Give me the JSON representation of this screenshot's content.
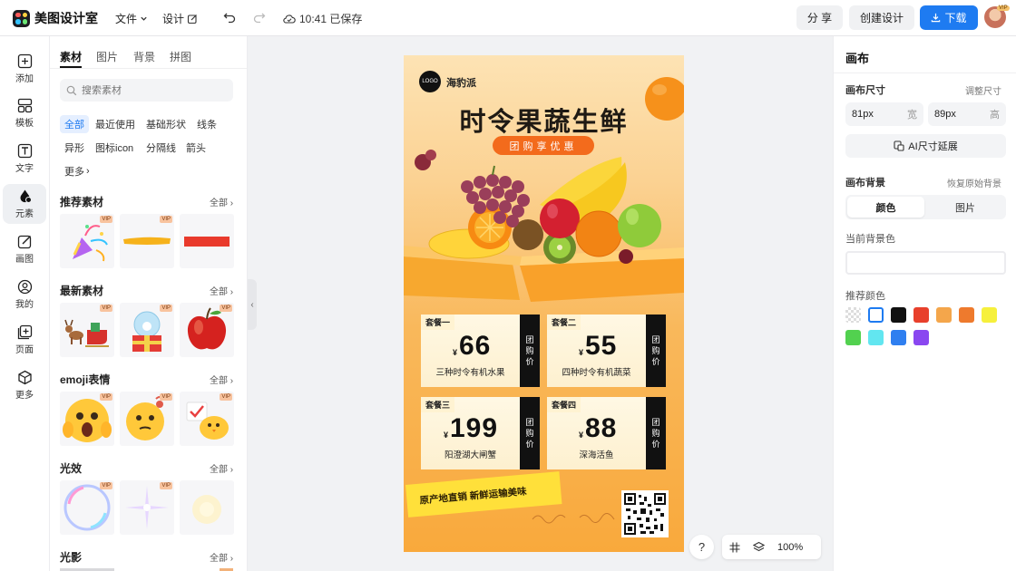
{
  "topbar": {
    "app_name": "美图设计室",
    "menu_file": "文件",
    "menu_design": "设计",
    "save_status": "10:41 已保存",
    "share": "分 享",
    "create_design": "创建设计",
    "download": "下载",
    "avatar_badge": "VIP",
    "accent_color": "#1e7bf1"
  },
  "rail": {
    "items": [
      {
        "icon": "plus-square-icon",
        "label": "添加"
      },
      {
        "icon": "template-icon",
        "label": "模板"
      },
      {
        "icon": "text-icon",
        "label": "文字"
      },
      {
        "icon": "element-icon",
        "label": "元素"
      },
      {
        "icon": "draw-icon",
        "label": "画图"
      },
      {
        "icon": "user-icon",
        "label": "我的"
      },
      {
        "icon": "add-page-icon",
        "label": "页面"
      },
      {
        "icon": "more-icon",
        "label": "更多"
      }
    ],
    "active": "元素"
  },
  "panel": {
    "tabs": [
      "素材",
      "图片",
      "背景",
      "拼图"
    ],
    "search_placeholder": "搜索素材",
    "chips": [
      "全部",
      "最近使用",
      "基础形状",
      "线条",
      "异形",
      "图标icon",
      "分隔线",
      "箭头",
      "更多"
    ],
    "all_label": "全部",
    "vip": "VIP",
    "sections": [
      {
        "title": "推荐素材",
        "thumbs": [
          "party-popper",
          "yellow-brush-stroke",
          "red-bar"
        ]
      },
      {
        "title": "最新素材",
        "thumbs": [
          "reindeer-sleigh",
          "snow-globe-gift",
          "red-apple"
        ]
      },
      {
        "title": "emoji表情",
        "thumbs": [
          "scared-emoji",
          "thinking-emoji",
          "chick-emoji"
        ]
      },
      {
        "title": "光效",
        "thumbs": [
          "bubble-light",
          "sparkle-light",
          "glow-light"
        ]
      },
      {
        "title": "光影",
        "thumbs": []
      }
    ]
  },
  "poster": {
    "logo": "LOGO",
    "brand": "海豹派",
    "title": "时令果蔬生鲜",
    "promo": "团购享优惠",
    "yen": "¥",
    "strip": [
      "团",
      "购",
      "价"
    ],
    "cards": [
      {
        "tag": "套餐一",
        "price": "66",
        "desc": "三种时令有机水果"
      },
      {
        "tag": "套餐二",
        "price": "55",
        "desc": "四种时令有机蔬菜"
      },
      {
        "tag": "套餐三",
        "price": "199",
        "desc": "阳澄湖大闸蟹"
      },
      {
        "tag": "套餐四",
        "price": "88",
        "desc": "深海活鱼"
      }
    ],
    "banner": "原产地直销  新鲜运输美味"
  },
  "zoom": {
    "help": "?",
    "level": "100%"
  },
  "rightpanel": {
    "title": "画布",
    "size_label": "画布尺寸",
    "size_link": "调整尺寸",
    "width_value": "81px",
    "width_unit": "宽",
    "height_value": "89px",
    "height_unit": "高",
    "ai_extend": "AI尺寸延展",
    "bg_label": "画布背景",
    "bg_reset": "恢复原始背景",
    "seg_color": "颜色",
    "seg_image": "图片",
    "current_bg_label": "当前背景色",
    "recommend_label": "推荐颜色",
    "swatches": [
      "transparent",
      "#ffffff",
      "#111111",
      "#e8402c",
      "#f4a64b",
      "#ee7a2d",
      "#f6f03c",
      "#52d14f",
      "#62e6f0",
      "#2f7ff0",
      "#8a47f0"
    ]
  }
}
